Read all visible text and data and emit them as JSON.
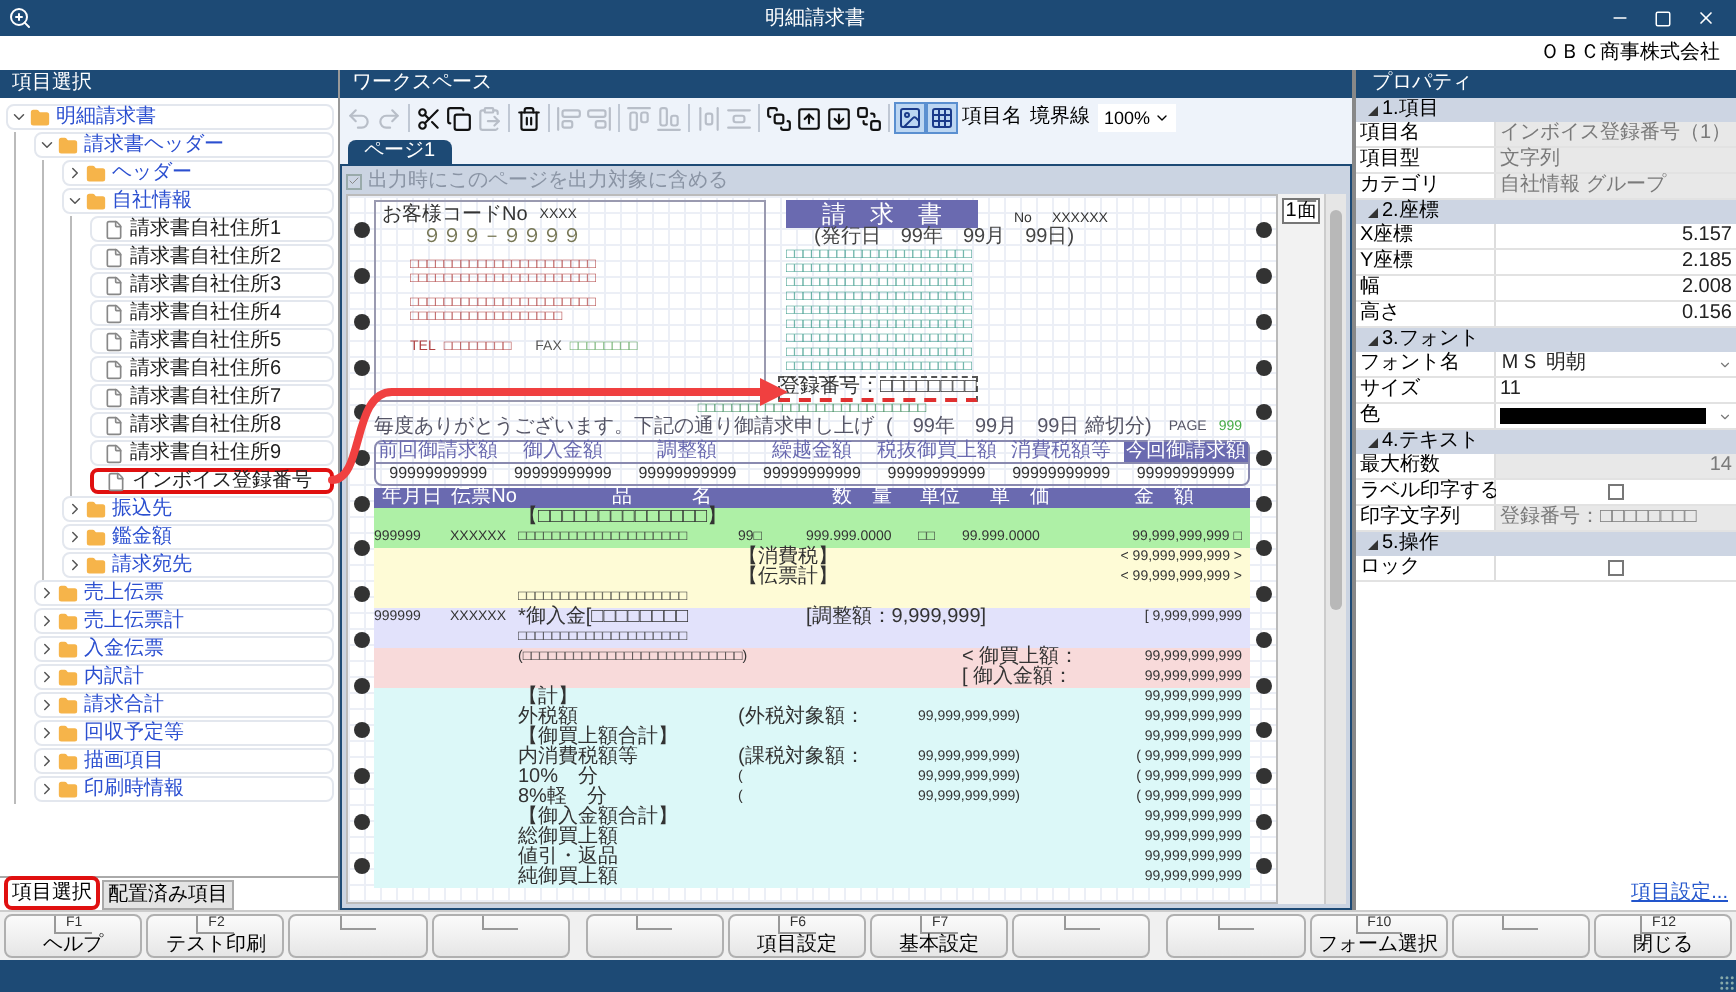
{
  "window": {
    "title": "明細請求書",
    "company": "ＯＢＣ商事株式会社"
  },
  "item_panel": {
    "title": "項目選択",
    "tree": [
      {
        "kind": "folder",
        "label": "明細請求書",
        "expanded": true,
        "highlighted": false,
        "children": [
          {
            "kind": "folder",
            "label": "請求書ヘッダー",
            "expanded": true,
            "highlighted": false,
            "children": [
              {
                "kind": "folder",
                "label": "ヘッダー",
                "expanded": false,
                "highlighted": false
              },
              {
                "kind": "folder",
                "label": "自社情報",
                "expanded": true,
                "highlighted": false,
                "children": [
                  {
                    "kind": "item",
                    "label": "請求書自社住所1",
                    "highlighted": false
                  },
                  {
                    "kind": "item",
                    "label": "請求書自社住所2",
                    "highlighted": false
                  },
                  {
                    "kind": "item",
                    "label": "請求書自社住所3",
                    "highlighted": false
                  },
                  {
                    "kind": "item",
                    "label": "請求書自社住所4",
                    "highlighted": false
                  },
                  {
                    "kind": "item",
                    "label": "請求書自社住所5",
                    "highlighted": false
                  },
                  {
                    "kind": "item",
                    "label": "請求書自社住所6",
                    "highlighted": false
                  },
                  {
                    "kind": "item",
                    "label": "請求書自社住所7",
                    "highlighted": false
                  },
                  {
                    "kind": "item",
                    "label": "請求書自社住所8",
                    "highlighted": false
                  },
                  {
                    "kind": "item",
                    "label": "請求書自社住所9",
                    "highlighted": false
                  },
                  {
                    "kind": "item",
                    "label": "インボイス登録番号",
                    "highlighted": true
                  }
                ]
              },
              {
                "kind": "folder",
                "label": "振込先",
                "expanded": false,
                "highlighted": false
              },
              {
                "kind": "folder",
                "label": "鑑金額",
                "expanded": false,
                "highlighted": false
              },
              {
                "kind": "folder",
                "label": "請求宛先",
                "expanded": false,
                "highlighted": false
              }
            ]
          },
          {
            "kind": "folder",
            "label": "売上伝票",
            "expanded": false,
            "highlighted": false
          },
          {
            "kind": "folder",
            "label": "売上伝票計",
            "expanded": false,
            "highlighted": false
          },
          {
            "kind": "folder",
            "label": "入金伝票",
            "expanded": false,
            "highlighted": false
          },
          {
            "kind": "folder",
            "label": "内訳計",
            "expanded": false,
            "highlighted": false
          },
          {
            "kind": "folder",
            "label": "請求合計",
            "expanded": false,
            "highlighted": false
          },
          {
            "kind": "folder",
            "label": "回収予定等",
            "expanded": false,
            "highlighted": false
          },
          {
            "kind": "folder",
            "label": "描画項目",
            "expanded": false,
            "highlighted": false
          },
          {
            "kind": "folder",
            "label": "印刷時情報",
            "expanded": false,
            "highlighted": false
          }
        ]
      }
    ],
    "tabs": [
      {
        "label": "項目選択",
        "selected": true,
        "highlighted": true
      },
      {
        "label": "配置済み項目",
        "selected": false,
        "highlighted": false
      }
    ]
  },
  "workspace": {
    "title": "ワークスペース",
    "tools": [
      {
        "kind": "undo",
        "disabled": true
      },
      {
        "kind": "redo",
        "disabled": true
      },
      {
        "kind": "sep"
      },
      {
        "kind": "cut",
        "disabled": false
      },
      {
        "kind": "copy",
        "disabled": false
      },
      {
        "kind": "paste",
        "disabled": true
      },
      {
        "kind": "sep"
      },
      {
        "kind": "delete",
        "disabled": false
      },
      {
        "kind": "sep"
      },
      {
        "kind": "align_left",
        "disabled": true
      },
      {
        "kind": "align_right",
        "disabled": true
      },
      {
        "kind": "sep"
      },
      {
        "kind": "align_top",
        "disabled": true
      },
      {
        "kind": "align_bottom",
        "disabled": true
      },
      {
        "kind": "sep"
      },
      {
        "kind": "space_h",
        "disabled": true
      },
      {
        "kind": "space_v",
        "disabled": true
      },
      {
        "kind": "sep"
      },
      {
        "kind": "front",
        "disabled": false
      },
      {
        "kind": "forward",
        "disabled": false
      },
      {
        "kind": "backward",
        "disabled": false
      },
      {
        "kind": "back",
        "disabled": false
      },
      {
        "kind": "sep"
      },
      {
        "kind": "image",
        "selected": true
      },
      {
        "kind": "grid",
        "selected": true
      },
      {
        "kind": "text",
        "label": "項目名",
        "selected": false
      },
      {
        "kind": "text",
        "label": "境界線",
        "selected": false
      },
      {
        "kind": "zoom",
        "value": "100%"
      }
    ],
    "page_tabs": [
      {
        "label": "ページ1",
        "selected": true
      }
    ],
    "include_page": {
      "label": "出力時にこのページを出力対象に含める",
      "checked": true,
      "disabled": true
    },
    "page_count": "1面",
    "form": {
      "customer_code_label": "お客様コードNo",
      "customer_code": "XXXX",
      "postal": "９９９－９９９９",
      "address_rows": [
        "□□□□□□□□□□□□□□□□□□□□□□",
        "□□□□□□□□□□□□□□□□□□□□□□",
        "□□□□□□□□□□□□□□□□□□□□□□",
        "□□□□□□□□□□□□□□□□□□"
      ],
      "tel_label": "TEL",
      "tel": "□□□□□□□□",
      "fax_label": "FAX",
      "fax": "□□□□□□□□",
      "title": "請　求　書",
      "number_label": "No",
      "number": "XXXXXX",
      "issue_date": "(発行日　99年　99月　99日)",
      "company_rows": [
        "□□□□□□□□□□□□□□□□□□□□□□",
        "□□□□□□□□□□□□□□□□□□□□□□",
        "□□□□□□□□□□□□□□□□□□□□□□",
        "□□□□□□□□□□□□□□□□□□□□□□",
        "□□□□□□□□□□□□□□□□□□□□□□",
        "□□□□□□□□□□□□□□□□□□□□□□",
        "□□□□□□□□□□□□□□□□□□□□□□",
        "□□□□□□□□□□□□□□□□□□□□□□",
        "□□□□□□□□□□□□□□□□□□□□□□"
      ],
      "registration": {
        "text": "登録番号：□□□□□□□□",
        "selected": true
      },
      "bank_row": "□□□□□□□□□□□□□□□□□□□□□□□□□□□",
      "greeting": "毎度ありがとうございます。下記の通り御請求申し上げ",
      "closing_date": "(　99年　99月　99日 締切分)",
      "page_label": "PAGE",
      "page_number": "999",
      "summary": [
        {
          "label": "前回御請求額",
          "value": "99999999999",
          "emphasized": false
        },
        {
          "label": "御入金額",
          "value": "99999999999",
          "emphasized": false
        },
        {
          "label": "調整額",
          "value": "99999999999",
          "emphasized": false
        },
        {
          "label": "繰越金額",
          "value": "99999999999",
          "emphasized": false
        },
        {
          "label": "税抜御買上額",
          "value": "99999999999",
          "emphasized": false
        },
        {
          "label": "消費税額等",
          "value": "99999999999",
          "emphasized": false
        },
        {
          "label": "今回御請求額",
          "value": "99999999999",
          "emphasized": true
        }
      ],
      "detail_header": {
        "date": "年月日",
        "slip": "伝票No",
        "name": "品　　　名",
        "qty": "数　量",
        "unit": "単位",
        "price": "単　価",
        "amount": "金　額"
      },
      "bands": [
        {
          "color": "#aef0a6",
          "lines": [
            {
              "name": "【□□□□□□□□□□□□□□】"
            },
            {
              "date": "999999",
              "slip": "XXXXXX",
              "name": "□□□□□□□□□□□□□□□□□□□□",
              "note": "99□",
              "qty": "999.999.0000",
              "unit": "□□",
              "price": "99.999.0000",
              "amount": "99,999,999,999 □"
            }
          ]
        },
        {
          "color": "#fefbd6",
          "lines": [
            {
              "note": "【消費税】",
              "amount": "< 99,999,999,999 >"
            },
            {
              "note": "【伝票計】",
              "amount": "< 99,999,999,999 >"
            },
            {
              "name": "□□□□□□□□□□□□□□□□□□□□"
            }
          ]
        },
        {
          "color": "#e2e2fb",
          "lines": [
            {
              "date": "999999",
              "slip": "XXXXXX",
              "name": "*御入金[□□□□□□□□",
              "qty": "[調整額：9,999,999]",
              "amount": "[ 9,999,999,999"
            },
            {
              "name": "□□□□□□□□□□□□□□□□□□□□"
            }
          ]
        },
        {
          "color": "#f8dada",
          "lines": [
            {
              "name": "(□□□□□□□□□□□□□□□□□□□□□□□□□□)",
              "price": "< 御買上額：",
              "amount": "99,999,999,999"
            },
            {
              "price": "[ 御入金額：",
              "amount": "99,999,999,999"
            }
          ]
        },
        {
          "color": "#dcf8f8",
          "lines": [
            {
              "name": "【計】",
              "amount": "99,999,999,999"
            },
            {
              "name": "外税額",
              "note": "(外税対象額：",
              "unit": "99,999,999,999)",
              "amount": "99,999,999,999"
            },
            {
              "name": "【御買上額合計】",
              "amount": "99,999,999,999"
            },
            {
              "name": "内消費税額等",
              "note": "(課税対象額：",
              "unit": "99,999,999,999)",
              "amount": "( 99,999,999,999"
            },
            {
              "name": "10%　分",
              "note": "(",
              "unit": "99,999,999,999)",
              "amount": "( 99,999,999,999"
            },
            {
              "name": "8%軽　分",
              "note": "(",
              "unit": "99,999,999,999)",
              "amount": "( 99,999,999,999"
            },
            {
              "name": "【御入金額合計】",
              "amount": "99,999,999,999"
            },
            {
              "name": "総御買上額",
              "amount": "99,999,999,999"
            },
            {
              "name": "値引・返品",
              "amount": "99,999,999,999"
            },
            {
              "name": "純御買上額",
              "amount": "99,999,999,999"
            }
          ]
        }
      ]
    }
  },
  "properties": {
    "title": "プロパティ",
    "sections": [
      {
        "title": "1.項目",
        "rows": [
          {
            "label": "項目名",
            "kind": "text",
            "value": "インボイス登録番号（1）",
            "readonly": true
          },
          {
            "label": "項目型",
            "kind": "text",
            "value": "文字列",
            "readonly": true
          },
          {
            "label": "カテゴリ",
            "kind": "text",
            "value": "自社情報 グループ",
            "readonly": true
          }
        ]
      },
      {
        "title": "2.座標",
        "rows": [
          {
            "label": "X座標",
            "kind": "number",
            "value": "5.157",
            "readonly": false
          },
          {
            "label": "Y座標",
            "kind": "number",
            "value": "2.185",
            "readonly": false
          },
          {
            "label": "幅",
            "kind": "number",
            "value": "2.008",
            "readonly": false
          },
          {
            "label": "高さ",
            "kind": "number",
            "value": "0.156",
            "readonly": false
          }
        ]
      },
      {
        "title": "3.フォント",
        "rows": [
          {
            "label": "フォント名",
            "kind": "select",
            "value": "ＭＳ 明朝",
            "readonly": false
          },
          {
            "label": "サイズ",
            "kind": "text",
            "value": "11",
            "readonly": false
          },
          {
            "label": "色",
            "kind": "color",
            "color": "#000000",
            "readonly": false
          }
        ]
      },
      {
        "title": "4.テキスト",
        "rows": [
          {
            "label": "最大桁数",
            "kind": "number",
            "value": "14",
            "readonly": true
          },
          {
            "label": "ラベル印字する",
            "kind": "checkbox",
            "checked": false,
            "readonly": false
          },
          {
            "label": "印字文字列",
            "kind": "text",
            "value": "登録番号：□□□□□□□□",
            "readonly": true
          }
        ]
      },
      {
        "title": "5.操作",
        "rows": [
          {
            "label": "ロック",
            "kind": "checkbox",
            "checked": false,
            "readonly": false
          }
        ]
      }
    ],
    "link": "項目設定..."
  },
  "function_keys": [
    {
      "kind": "key",
      "key": "F1",
      "label": "ヘルプ"
    },
    {
      "kind": "key",
      "key": "F2",
      "label": "テスト印刷"
    },
    {
      "kind": "blank"
    },
    {
      "kind": "blank"
    },
    {
      "kind": "blank"
    },
    {
      "kind": "key",
      "key": "F6",
      "label": "項目設定"
    },
    {
      "kind": "key",
      "key": "F7",
      "label": "基本設定"
    },
    {
      "kind": "blank"
    },
    {
      "kind": "blank"
    },
    {
      "kind": "key",
      "key": "F10",
      "label": "フォーム選択"
    },
    {
      "kind": "blank"
    },
    {
      "kind": "key",
      "key": "F12",
      "label": "閉じる"
    }
  ]
}
